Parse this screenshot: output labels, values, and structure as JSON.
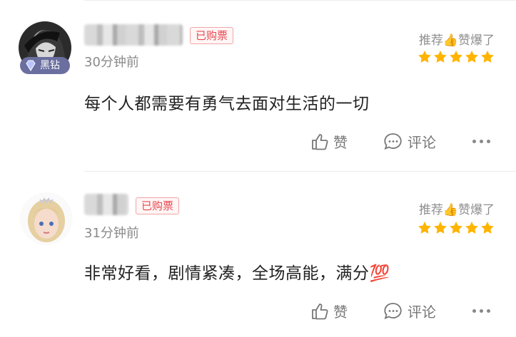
{
  "reviews": [
    {
      "user_badge": "黑钻",
      "purchased": "已购票",
      "time": "30分钟前",
      "recommend": "推荐👍赞爆了",
      "stars": 5,
      "content": "每个人都需要有勇气去面对生活的一切",
      "like_label": "赞",
      "comment_label": "评论"
    },
    {
      "purchased": "已购票",
      "time": "31分钟前",
      "recommend": "推荐👍赞爆了",
      "stars": 5,
      "content": "非常好看，剧情紧凑，全场高能，满分💯",
      "like_label": "赞",
      "comment_label": "评论"
    }
  ],
  "colors": {
    "star": "#ffb400",
    "purchased_text": "#e8484f",
    "vip_badge": "#6b6f9f"
  }
}
